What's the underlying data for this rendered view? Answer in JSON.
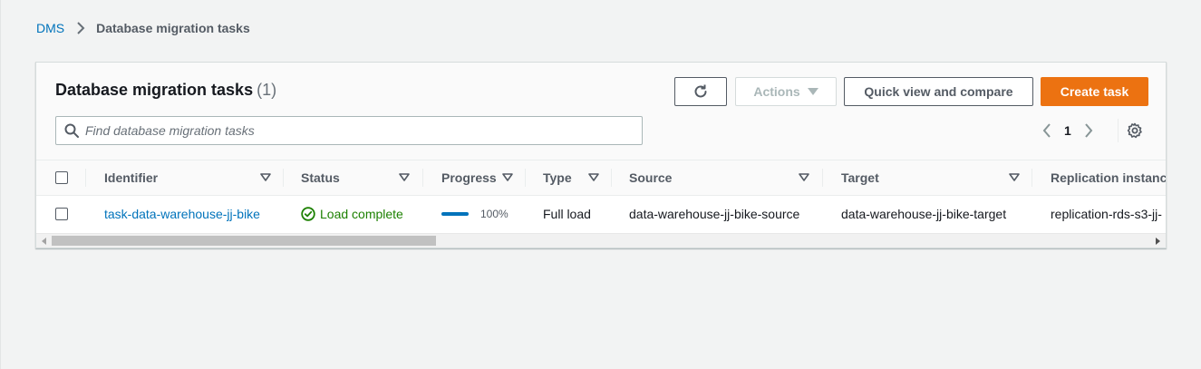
{
  "breadcrumb": {
    "root": "DMS",
    "current": "Database migration tasks"
  },
  "panel": {
    "title": "Database migration tasks",
    "count": "(1)"
  },
  "toolbar": {
    "refresh_icon": "refresh-icon",
    "actions_label": "Actions",
    "quick_view_label": "Quick view and compare",
    "create_label": "Create task"
  },
  "search": {
    "placeholder": "Find database migration tasks",
    "value": ""
  },
  "pagination": {
    "current_page": "1"
  },
  "table": {
    "columns": [
      "Identifier",
      "Status",
      "Progress",
      "Type",
      "Source",
      "Target",
      "Replication instance"
    ],
    "rows": [
      {
        "identifier": "task-data-warehouse-jj-bike",
        "status": "Load complete",
        "progress_text": "100%",
        "progress_value": 1.0,
        "type": "Full load",
        "source": "data-warehouse-jj-bike-source",
        "target": "data-warehouse-jj-bike-target",
        "replication_instance": "replication-rds-s3-jj-"
      }
    ]
  },
  "colors": {
    "link": "#0073bb",
    "primary_button": "#ec7211",
    "success": "#1d8102",
    "header_text": "#545b64"
  }
}
